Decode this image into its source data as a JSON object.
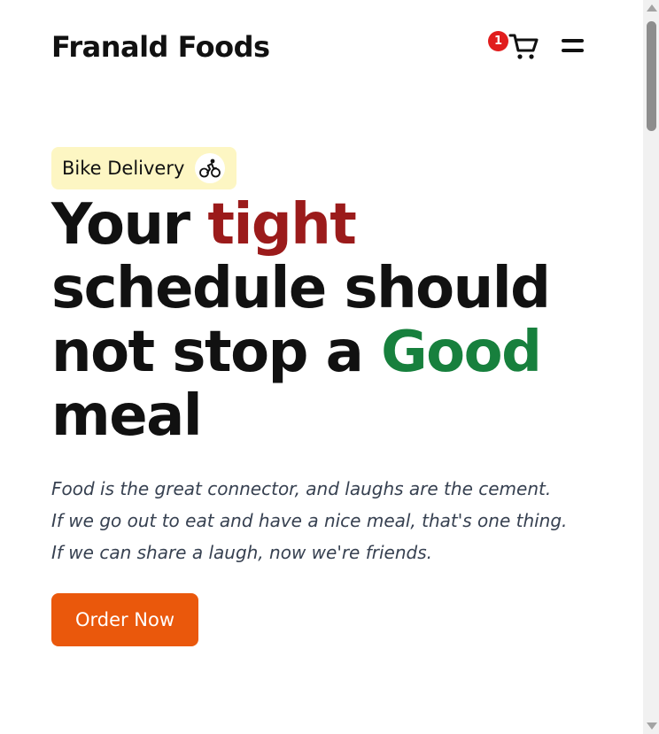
{
  "header": {
    "brand": "Franald Foods",
    "cart_count": "1",
    "cart_icon": "cart-icon",
    "menu_icon": "menu-icon"
  },
  "hero": {
    "badge_label": "Bike Delivery",
    "badge_icon": "bicycle-icon",
    "headline": {
      "w1": "Your ",
      "w2": "tight",
      "line2": "schedule should",
      "w3": "not stop a ",
      "w4": "Good",
      "line4": "meal"
    },
    "tagline": [
      "Food is the great connector, and laughs are the cement.",
      "If we go out to eat and have a nice meal, that's one thing.",
      "If we can share a laugh, now we're friends."
    ],
    "cta_label": "Order Now"
  },
  "colors": {
    "accent_red": "#9b1b1b",
    "accent_green": "#17803d",
    "cta": "#ea580c",
    "badge_bg": "#fdf6c3",
    "cart_badge": "#e11d1d"
  }
}
